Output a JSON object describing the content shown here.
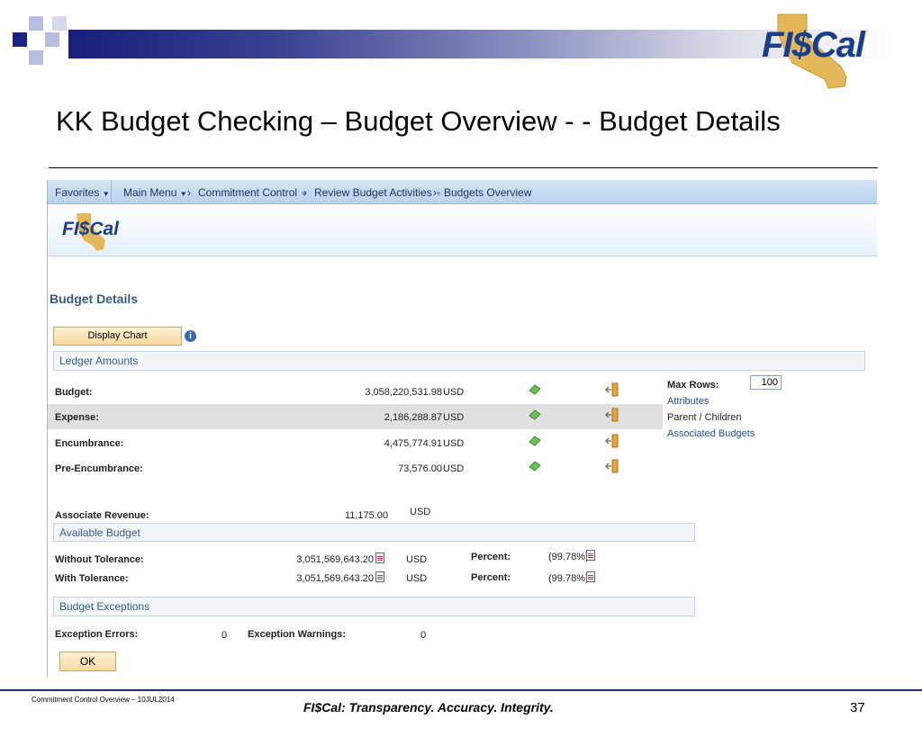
{
  "slide": {
    "title": "KK Budget Checking – Budget Overview - - Budget Details",
    "logo_text": "FI$Cal",
    "footer_left": "Commitment Control Overview – 10JUL2014",
    "footer_center": "FI$Cal:  Transparency.  Accuracy.  Integrity.",
    "page_number": "37",
    "colors": {
      "header_bar": "#1a1f7a",
      "logo_state": "#e3b85a",
      "logo_text": "#1a3e8c"
    }
  },
  "nav": {
    "favorites": "Favorites",
    "main_menu": "Main Menu",
    "crumbs": [
      "Commitment Control",
      "Review Budget Activities",
      "Budgets Overview"
    ]
  },
  "app_logo_text": "FI$Cal",
  "page": {
    "title": "Budget Details",
    "display_chart_label": "Display Chart",
    "ok_label": "OK"
  },
  "ledger": {
    "header": "Ledger Amounts",
    "rows": [
      {
        "label": "Budget:",
        "amount": "3,058,220,531.98",
        "currency": "USD"
      },
      {
        "label": "Expense:",
        "amount": "2,186,288.87",
        "currency": "USD"
      },
      {
        "label": "Encumbrance:",
        "amount": "4,475,774.91",
        "currency": "USD"
      },
      {
        "label": "Pre-Encumbrance:",
        "amount": "73,576.00",
        "currency": "USD"
      }
    ],
    "max_rows_label": "Max Rows:",
    "max_rows_value": "100",
    "attributes_link": "Attributes",
    "parent_children": "Parent / Children",
    "associated_budgets_link": "Associated Budgets"
  },
  "revenue": {
    "label": "Associate Revenue:",
    "amount": "11,175.00",
    "currency": "USD"
  },
  "available": {
    "header": "Available Budget",
    "rows": [
      {
        "label": "Without Tolerance:",
        "amount": "3,051,569,643.20",
        "currency": "USD",
        "percent_label": "Percent:",
        "percent": "(99.78%)"
      },
      {
        "label": "With Tolerance:",
        "amount": "3,051,569,643.20",
        "currency": "USD",
        "percent_label": "Percent:",
        "percent": "(99.78%)"
      }
    ]
  },
  "exceptions": {
    "header": "Budget Exceptions",
    "errors_label": "Exception Errors:",
    "errors_value": "0",
    "warnings_label": "Exception Warnings:",
    "warnings_value": "0"
  }
}
